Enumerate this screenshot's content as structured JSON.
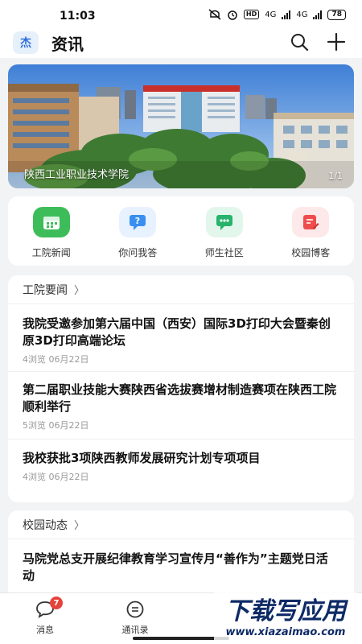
{
  "status_bar": {
    "time": "11:03",
    "network": "4G",
    "hd": "HD",
    "battery": "78"
  },
  "header": {
    "logo_text": "杰",
    "title": "资讯"
  },
  "banner": {
    "caption": "陕西工业职业技术学院",
    "page_indicator": "1/1",
    "building_sign": "陕西工院"
  },
  "shortcuts": [
    {
      "label": "工院新闻",
      "color": "#3dbd5a",
      "icon": "calendar-icon"
    },
    {
      "label": "你问我答",
      "color": "#3a8ef0",
      "icon": "question-chat-icon"
    },
    {
      "label": "师生社区",
      "color": "#27b36b",
      "icon": "chat-bubble-icon"
    },
    {
      "label": "校园博客",
      "color": "#ef4d4d",
      "icon": "edit-note-icon"
    }
  ],
  "news_sections": [
    {
      "title": "工院要闻",
      "items": [
        {
          "title": "我院受邀参加第六届中国（西安）国际3D打印大会暨秦创原3D打印高端论坛",
          "views": "4浏览",
          "date": "06月22日"
        },
        {
          "title": "第二届职业技能大赛陕西省选拔赛增材制造赛项在陕西工院顺利举行",
          "views": "5浏览",
          "date": "06月22日"
        },
        {
          "title": "我校获批3项陕西教师发展研究计划专项项目",
          "views": "4浏览",
          "date": "06月22日"
        }
      ]
    },
    {
      "title": "校园动态",
      "items": [
        {
          "title": "马院党总支开展纪律教育学习宣传月“善作为”主题党日活动",
          "views": "",
          "date": ""
        }
      ]
    }
  ],
  "bottom_nav": [
    {
      "label": "消息",
      "badge": "7",
      "icon": "message-icon"
    },
    {
      "label": "通讯录",
      "badge": "",
      "icon": "contacts-icon"
    }
  ],
  "watermark": {
    "text": "下载写应用",
    "url": "www.xiazaimao.com"
  },
  "colors": {
    "accent": "#2f6fd8",
    "badge": "#e4423b",
    "background": "#f2f3f5"
  }
}
